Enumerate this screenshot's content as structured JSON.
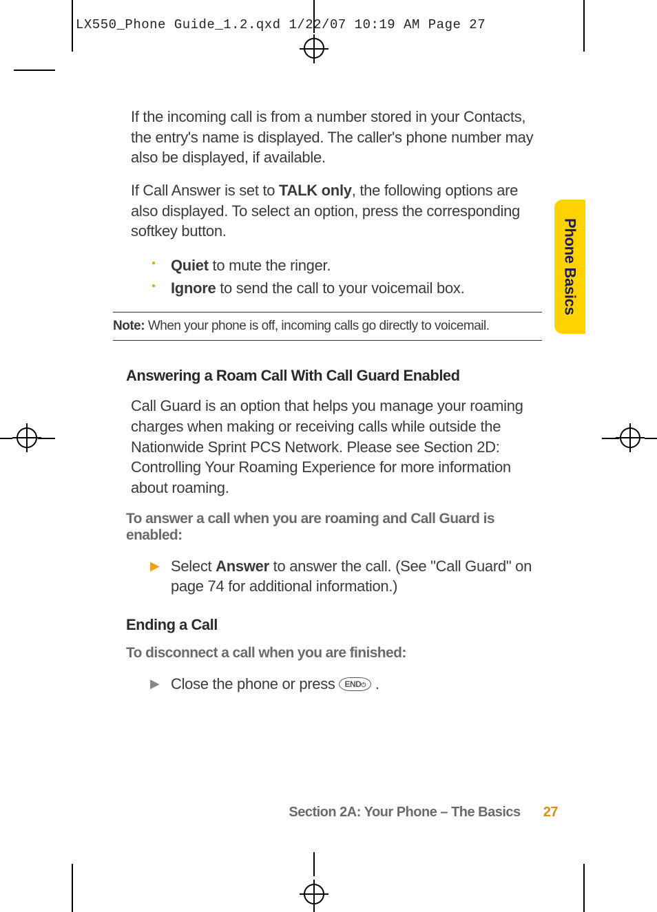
{
  "header": {
    "slug": "LX550_Phone Guide_1.2.qxd  1/22/07  10:19 AM  Page 27"
  },
  "sideTab": {
    "label": "Phone Basics"
  },
  "content": {
    "para1": "If the incoming call is from a number stored in your Contacts, the entry's name is displayed. The caller's phone number may also be displayed, if available.",
    "para2_pre": "If Call Answer is set to ",
    "para2_bold": "TALK only",
    "para2_post": ", the following options are also displayed. To select an option, press the corresponding softkey button.",
    "bullets": [
      {
        "bold": "Quiet",
        "rest": " to mute the ringer."
      },
      {
        "bold": "Ignore",
        "rest": " to send the call to your voicemail box."
      }
    ],
    "note": {
      "label": "Note: ",
      "text": "When your phone is off, incoming calls go directly to voicemail."
    },
    "heading1": "Answering a Roam Call With Call Guard Enabled",
    "para3": "Call Guard is an option that helps you manage your roaming charges when making or receiving calls while outside the Nationwide Sprint PCS Network. Please see Section 2D: Controlling Your Roaming Experience for more information about roaming.",
    "subhead1": "To answer a call when you are roaming and Call Guard is enabled:",
    "arrow1_pre": "Select ",
    "arrow1_bold": "Answer",
    "arrow1_post": " to answer the call. (See \"Call Guard\" on page 74 for additional information.)",
    "heading2": "Ending a Call",
    "subhead2": "To disconnect a call when you are finished:",
    "arrow2_pre": "Close the phone or press ",
    "endButtonLabel": "END",
    "arrow2_post": " ."
  },
  "footer": {
    "sectionLabel": "Section 2A: Your Phone – The Basics",
    "pageNumber": "27"
  }
}
